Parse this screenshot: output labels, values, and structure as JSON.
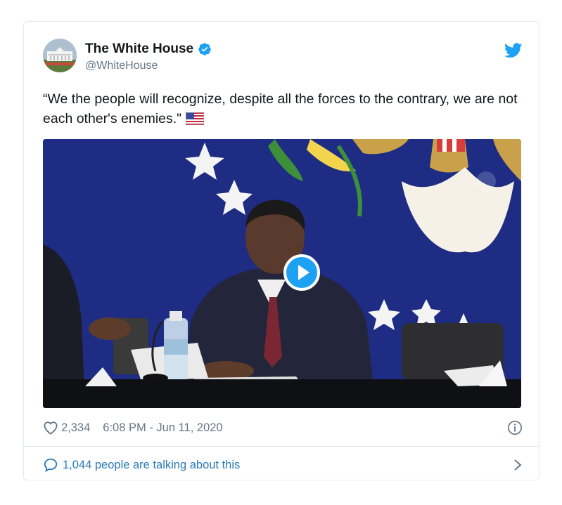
{
  "tweet": {
    "author_name": "The White House",
    "author_handle": "@WhiteHouse",
    "text": "“We the people will recognize, despite all the forces to the contrary, we are not each other's enemies.\"",
    "likes": "2,334",
    "timestamp": "6:08 PM - Jun 11, 2020",
    "talking": "1,044 people are talking about this"
  },
  "icons": {
    "verified": "verified-badge-icon",
    "bird": "twitter-bird-icon",
    "flag": "us-flag-emoji",
    "play": "play-icon",
    "heart": "heart-icon",
    "info": "info-icon",
    "bubble": "speech-bubble-icon",
    "chevron": "chevron-right-icon"
  },
  "colors": {
    "brand_blue": "#1da1f2",
    "link_blue": "#2b7bb9",
    "muted_gray": "#657786",
    "border": "#e1e8ed",
    "text": "#14171a"
  }
}
